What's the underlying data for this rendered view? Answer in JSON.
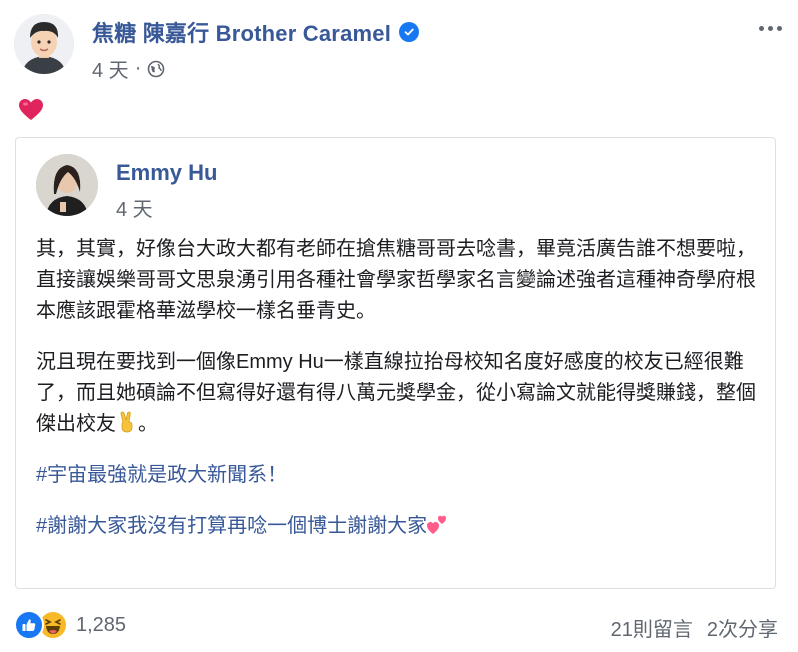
{
  "post": {
    "author": "焦糖 陳嘉行 Brother Caramel",
    "time": "4 天",
    "separator": "·",
    "privacy_icon": "globe-icon",
    "more_icon": "more-options-icon",
    "content_emoji": "red-heart-emoji"
  },
  "shared": {
    "author": "Emmy Hu",
    "time": "4 天",
    "paragraphs": [
      "其，其實，好像台大政大都有老師在搶焦糖哥哥去唸書，畢竟活廣告誰不想要啦，直接讓娛樂哥哥文思泉湧引用各種社會學家哲學家名言變論述強者這種神奇學府根本應該跟霍格華滋學校一樣名垂青史。",
      "況且現在要找到一個像Emmy Hu一樣直線拉抬母校知名度好感度的校友已經很難了，而且她碩論不但寫得好還有得八萬元獎學金，從小寫論文就能得獎賺錢，整個傑出校友",
      "。"
    ],
    "hashtag1": "#宇宙最強就是政大新聞系！",
    "hashtag2": "#謝謝大家我沒有打算再唸一個博士謝謝大家",
    "emojis": [
      "victory-hand-emoji",
      "two-hearts-emoji"
    ]
  },
  "footer": {
    "reaction_count": "1,285",
    "comments": "21則留言",
    "shares": "2次分享",
    "reaction_icons": [
      "like-icon",
      "haha-icon"
    ]
  },
  "colors": {
    "link": "#385898",
    "meta": "#606770",
    "verified": "#1877f2",
    "like": "#1877f2",
    "haha": "#f7b928",
    "border": "#dddfe2"
  }
}
